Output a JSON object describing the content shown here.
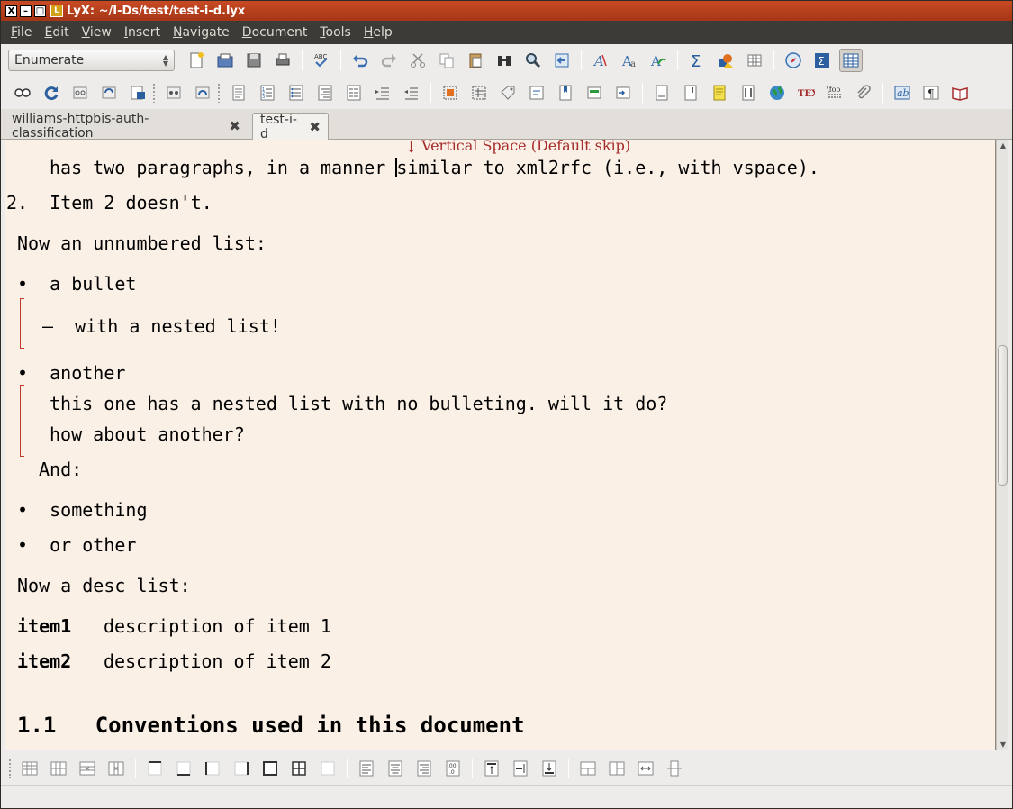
{
  "window": {
    "title": "LyX: ~/I-Ds/test/test-i-d.lyx",
    "buttons": [
      "X",
      "–",
      "□"
    ]
  },
  "menubar": {
    "items": [
      "File",
      "Edit",
      "View",
      "Insert",
      "Navigate",
      "Document",
      "Tools",
      "Help"
    ]
  },
  "toolbar": {
    "layout_combo": "Enumerate"
  },
  "tabs": [
    {
      "label": "williams-httpbis-auth-classification",
      "close": "✖"
    },
    {
      "label": "test-i-d",
      "close": "✖"
    }
  ],
  "document": {
    "vspace_label": "Vertical Space (Default skip)",
    "vspace_arrow": "↓",
    "lines": [
      "has two paragraphs, in a manner similar to xml2rfc (i.e., with vspace).",
      "2.  Item 2 doesn't.",
      "Now an unnumbered list:",
      "•  a bullet",
      "–  with a nested list!",
      "•  another",
      "this one has a nested list with no bulleting. will it do?",
      "how about another?",
      "And:",
      "•  something",
      "•  or other",
      "Now a desc list:",
      "description of item 1",
      "description of item 2"
    ],
    "desc_terms": [
      "item1",
      "item2"
    ],
    "section": "1.1   Conventions used in this document"
  },
  "colors": {
    "titlebar": "#b23e1b",
    "menubar": "#3c3b37",
    "work_bg": "#faf0e6",
    "vspace": "#a52a2a",
    "bracket": "#c0392b"
  }
}
